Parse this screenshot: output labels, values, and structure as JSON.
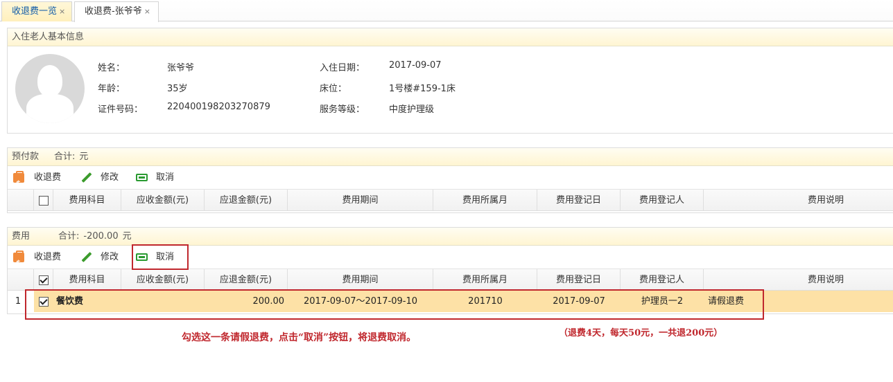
{
  "tabs": [
    {
      "label": "收退费一览",
      "close": "×"
    },
    {
      "label": "收退费-张爷爷",
      "close": "×"
    }
  ],
  "resident": {
    "panel_title": "入住老人基本信息",
    "fields": [
      {
        "label": "姓名：",
        "value": "张爷爷"
      },
      {
        "label": "年龄：",
        "value": "35岁"
      },
      {
        "label": "证件号码：",
        "value": "220400198203270879"
      },
      {
        "label": "入住日期：",
        "value": "2017-09-07"
      },
      {
        "label": "床位：",
        "value": "1号楼#159-1床"
      },
      {
        "label": "服务等级：",
        "value": "中度护理级"
      }
    ]
  },
  "prepaid": {
    "title": "预付款",
    "total_label": "合计:",
    "total_value": "",
    "unit": "元"
  },
  "fees": {
    "title": "费用",
    "total_label": "合计:",
    "total_value": "-200.00",
    "unit": "元"
  },
  "toolbar": {
    "charge_label": "收退费",
    "edit_label": "修改",
    "cancel_label": "取消"
  },
  "columns": [
    "费用科目",
    "应收金额(元)",
    "应退金额(元)",
    "费用期间",
    "费用所属月",
    "费用登记日",
    "费用登记人",
    "费用说明"
  ],
  "fee_rows": [
    {
      "index": "1",
      "checked": true,
      "item": "餐饮费",
      "receivable": "",
      "refund": "200.00",
      "period": "2017-09-07～2017-09-10",
      "month": "201710",
      "reg_date": "2017-09-07",
      "registrant": "护理员一2",
      "description": "请假退费"
    }
  ],
  "annotations": {
    "instruction": "勾选这一条请假退费，点击“取消”按钮，将退费取消。",
    "detail": "（退费4天，每天50元，一共退200元）"
  },
  "colors": {
    "highlight_red": "#c0272d",
    "selected_row": "#fde1a6",
    "panel_header": "#fff5d2",
    "tab_active_text": "#0e5aa7"
  }
}
